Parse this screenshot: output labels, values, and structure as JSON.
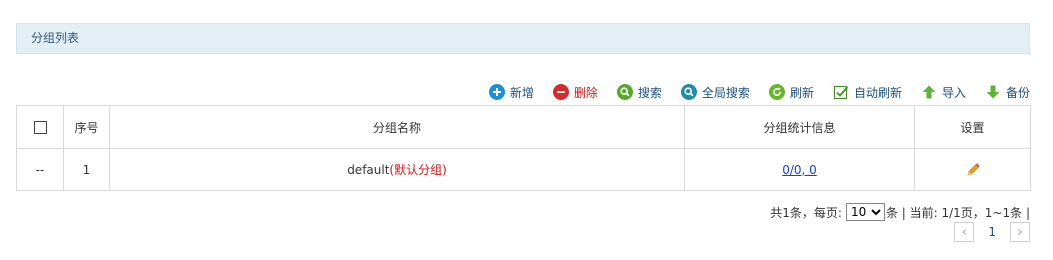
{
  "panel": {
    "title": "分组列表"
  },
  "toolbar": {
    "add": "新增",
    "delete": "删除",
    "search": "搜索",
    "global_search": "全局搜索",
    "refresh": "刷新",
    "auto_refresh": "自动刷新",
    "import": "导入",
    "backup": "备份"
  },
  "table": {
    "headers": {
      "seq": "序号",
      "name": "分组名称",
      "stats": "分组统计信息",
      "settings": "设置"
    },
    "rows": [
      {
        "check": "--",
        "seq": "1",
        "name": "default",
        "name_note": "(默认分组)",
        "stats": "0/0, 0"
      }
    ]
  },
  "pager": {
    "total_prefix": "共1条，每页:",
    "page_size": "10",
    "summary": "条 | 当前: 1/1页，1~1条 |",
    "current_page": "1",
    "prev": "‹",
    "next": "›"
  },
  "colors": {
    "accent_blue": "#1a4f7a",
    "danger_red": "#c71a1a",
    "header_bg": "#e4eef5"
  }
}
